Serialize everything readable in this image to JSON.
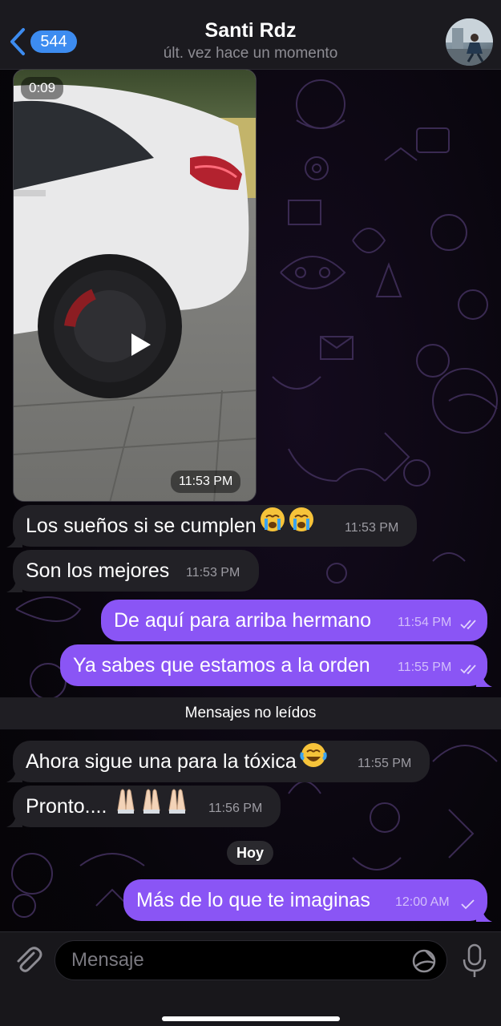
{
  "header": {
    "back_count": "544",
    "title": "Santi Rdz",
    "status": "últ. vez hace un momento"
  },
  "video": {
    "duration": "0:09",
    "time": "11:53 PM"
  },
  "messages": [
    {
      "direction": "in",
      "text": "Los sueños si se cumplen",
      "emoji": "😭😭",
      "time": "11:53 PM"
    },
    {
      "direction": "in",
      "text": "Son los mejores",
      "time": "11:53 PM"
    },
    {
      "direction": "out",
      "text": "De aquí para arriba hermano",
      "time": "11:54 PM",
      "read": true
    },
    {
      "direction": "out",
      "text": "Ya sabes que estamos a la orden",
      "time": "11:55 PM",
      "read": true
    },
    {
      "direction": "in",
      "text": "Ahora sigue una para la tóxica",
      "emoji": "😂",
      "time": "11:55 PM"
    },
    {
      "direction": "in",
      "text": "Pronto....",
      "emoji": "🙏🏻🙏🏻🙏🏻",
      "time": "11:56 PM"
    },
    {
      "direction": "out",
      "text": "Más de lo que te imaginas",
      "time": "12:00 AM",
      "read": false
    }
  ],
  "separators": {
    "unread": "Mensajes no leídos",
    "date": "Hoy"
  },
  "input": {
    "placeholder": "Mensaje"
  },
  "icons": [
    "chevron-left-icon",
    "play-icon",
    "paperclip-icon",
    "sticker-icon",
    "microphone-icon",
    "double-check-icon",
    "single-check-icon"
  ],
  "colors": {
    "outgoing_bubble": "#8a55f5",
    "incoming_bubble": "#222126",
    "badge": "#3d8cf0",
    "accent": "#3d8cf0"
  }
}
